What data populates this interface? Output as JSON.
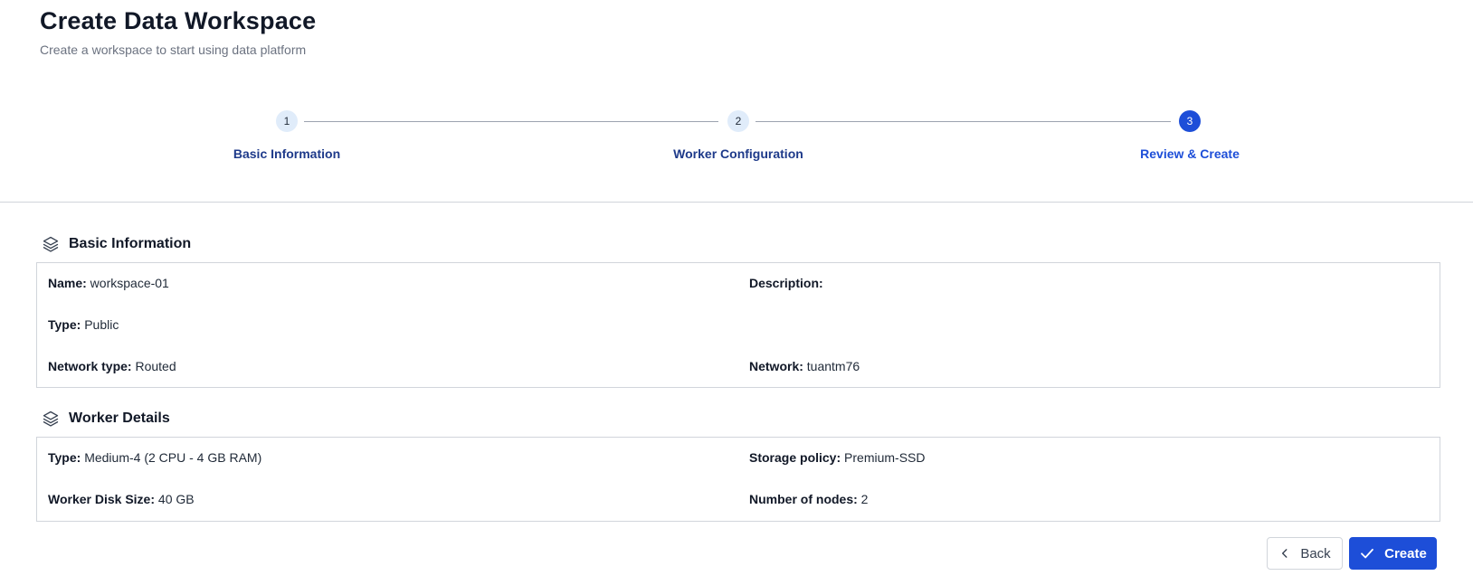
{
  "header": {
    "title": "Create Data Workspace",
    "subtitle": "Create a workspace to start using data platform"
  },
  "stepper": {
    "steps": [
      {
        "number": "1",
        "label": "Basic Information",
        "state": "done"
      },
      {
        "number": "2",
        "label": "Worker Configuration",
        "state": "done"
      },
      {
        "number": "3",
        "label": "Review & Create",
        "state": "active"
      }
    ]
  },
  "basic_info": {
    "title": "Basic Information",
    "icon": "layers-icon",
    "name": {
      "key": "Name:",
      "value": " workspace-01"
    },
    "description": {
      "key": "Description:",
      "value": ""
    },
    "type": {
      "key": "Type:",
      "value": " Public"
    },
    "network_type": {
      "key": "Network type:",
      "value": " Routed"
    },
    "network": {
      "key": "Network:",
      "value": " tuantm76"
    }
  },
  "worker_details": {
    "title": "Worker Details",
    "icon": "layers-icon",
    "type": {
      "key": "Type:",
      "value": " Medium-4 (2 CPU - 4 GB RAM)"
    },
    "storage_policy": {
      "key": "Storage policy:",
      "value": " Premium-SSD"
    },
    "disk_size": {
      "key": "Worker Disk Size:",
      "value": " 40 GB"
    },
    "nodes": {
      "key": "Number of nodes:",
      "value": " 2"
    }
  },
  "actions": {
    "back_label": "Back",
    "create_label": "Create"
  },
  "colors": {
    "primary": "#1d4ed8",
    "step_done_bg": "#e0ecfa",
    "step_label": "#1e3a8a",
    "border": "#d1d5db"
  }
}
